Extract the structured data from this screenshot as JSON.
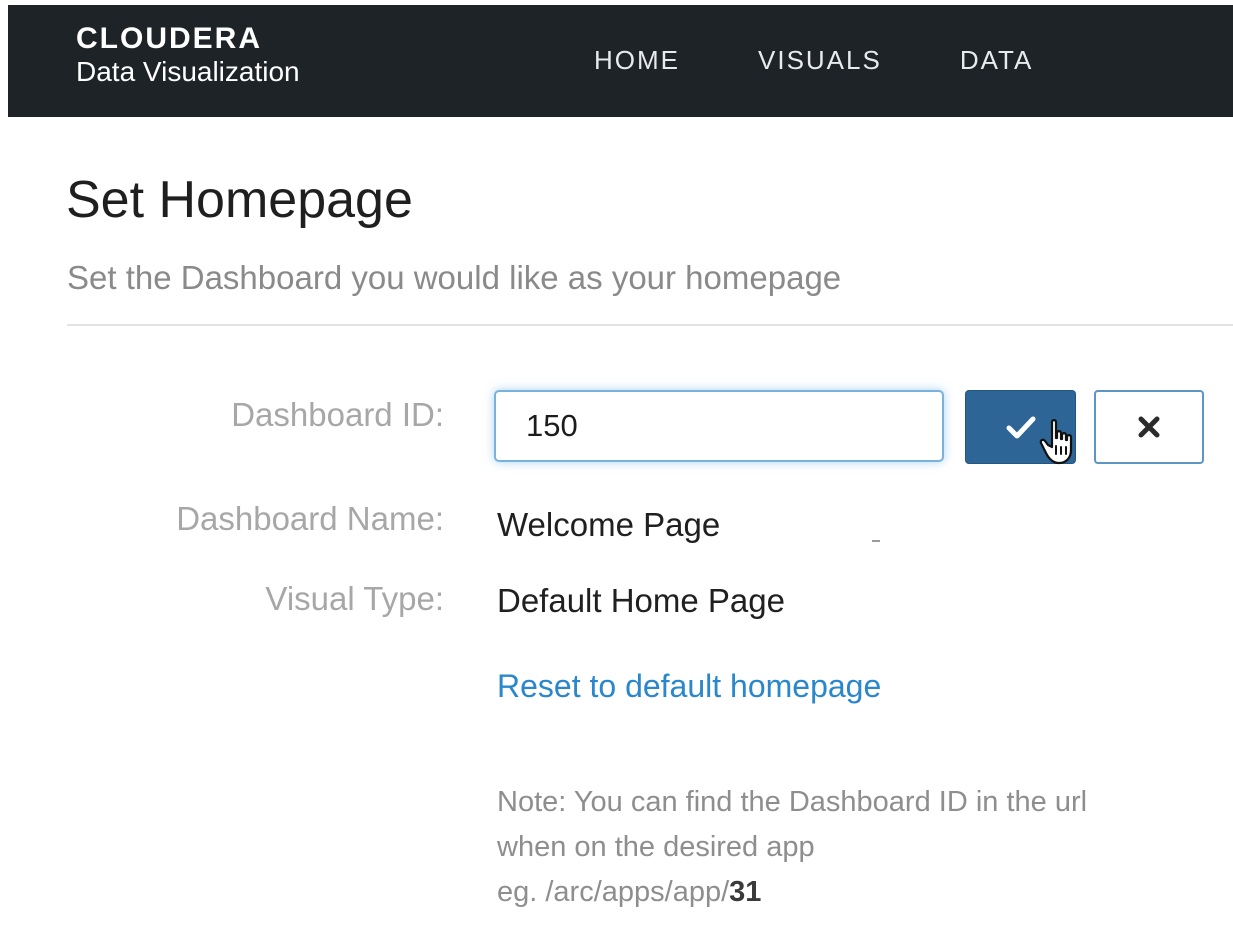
{
  "app": {
    "brand_name": "CLOUDERA",
    "brand_sub": "Data Visualization"
  },
  "nav": {
    "items": [
      "HOME",
      "VISUALS",
      "DATA"
    ]
  },
  "page": {
    "title": "Set Homepage",
    "subtitle": "Set the Dashboard you would like as your homepage"
  },
  "form": {
    "dashboard_id_label": "Dashboard ID:",
    "dashboard_id_value": "150",
    "dashboard_name_label": "Dashboard Name:",
    "dashboard_name_value": "Welcome Page",
    "visual_type_label": "Visual Type:",
    "visual_type_value": "Default Home Page",
    "confirm_icon": "check-icon",
    "cancel_icon": "close-icon",
    "reset_link": "Reset to default homepage"
  },
  "note": {
    "line1": "Note: You can find the Dashboard ID in the url",
    "line2": "when on the desired app",
    "line3_prefix": "eg. /arc/apps/app/",
    "line3_bold": "31"
  },
  "colors": {
    "topbar": "#1e2327",
    "primary": "#2d6596",
    "link": "#2a87cc",
    "focus": "#78b2dd"
  }
}
